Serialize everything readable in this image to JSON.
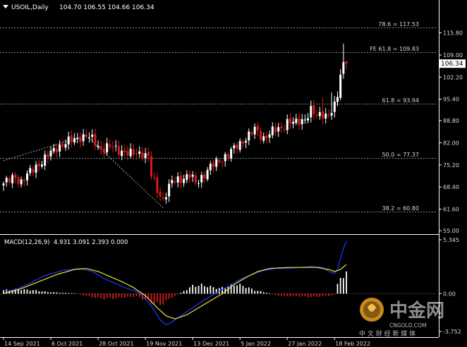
{
  "chart_data": [
    {
      "type": "candlestick",
      "title": "USOIL,Daily",
      "ohlc_readout": [
        "104.70",
        "106.55",
        "104.66",
        "106.34"
      ],
      "current_price": "106.34",
      "ylim": [
        55.0,
        122.0
      ],
      "y_ticks": [
        "115.80",
        "109.00",
        "102.20",
        "95.40",
        "88.80",
        "82.00",
        "75.20",
        "68.40",
        "61.60",
        "55.00"
      ],
      "x_labels": [
        {
          "t": 0,
          "label": "14 Sep 2021"
        },
        {
          "t": 16,
          "label": "6 Oct 2021"
        },
        {
          "t": 32,
          "label": "28 Oct 2021"
        },
        {
          "t": 48,
          "label": "19 Nov 2021"
        },
        {
          "t": 64,
          "label": "13 Dec 2021"
        },
        {
          "t": 80,
          "label": "5 Jan 2022"
        },
        {
          "t": 96,
          "label": "27 Jan 2022"
        },
        {
          "t": 112,
          "label": "18 Feb 2022"
        }
      ],
      "fib_levels": [
        {
          "label": "78.6 = 117.53",
          "value": 117.53
        },
        {
          "label": "FE 61.8 = 109.83",
          "value": 109.83
        },
        {
          "label": "61.8 = 93.94",
          "value": 93.94
        },
        {
          "label": "50.0 = 77.37",
          "value": 77.37
        },
        {
          "label": "38.2 = 60.80",
          "value": 60.8
        }
      ],
      "trendlines": [
        {
          "from": [
            0,
            76.5
          ],
          "to": [
            28,
            84.3
          ]
        },
        {
          "from": [
            28,
            84.3
          ],
          "to": [
            54,
            62.0
          ]
        }
      ],
      "anchors": [
        [
          0,
          69.5
        ],
        [
          4,
          71.5
        ],
        [
          6,
          70.0
        ],
        [
          9,
          73.0
        ],
        [
          12,
          75.5
        ],
        [
          15,
          78.0
        ],
        [
          18,
          80.5
        ],
        [
          21,
          82.0
        ],
        [
          24,
          83.0
        ],
        [
          26,
          83.8
        ],
        [
          28,
          84.0
        ],
        [
          30,
          83.0
        ],
        [
          33,
          80.0
        ],
        [
          36,
          80.8
        ],
        [
          40,
          79.5
        ],
        [
          43,
          78.5
        ],
        [
          47,
          79.0
        ],
        [
          49,
          77.5
        ],
        [
          50,
          72.0
        ],
        [
          52,
          67.5
        ],
        [
          54,
          64.5
        ],
        [
          55,
          66.5
        ],
        [
          57,
          70.0
        ],
        [
          60,
          71.0
        ],
        [
          63,
          72.0
        ],
        [
          65,
          69.5
        ],
        [
          67,
          71.5
        ],
        [
          70,
          74.5
        ],
        [
          73,
          76.5
        ],
        [
          76,
          78.5
        ],
        [
          79,
          81.0
        ],
        [
          82,
          83.5
        ],
        [
          85,
          86.0
        ],
        [
          88,
          83.5
        ],
        [
          91,
          85.5
        ],
        [
          94,
          86.5
        ],
        [
          96,
          88.5
        ],
        [
          99,
          88.0
        ],
        [
          102,
          89.5
        ],
        [
          104,
          92.0
        ],
        [
          106,
          90.0
        ],
        [
          108,
          91.0
        ],
        [
          110,
          90.5
        ],
        [
          112,
          93.0
        ],
        [
          113,
          96.5
        ],
        [
          114,
          103.0
        ],
        [
          115,
          106.5
        ],
        [
          116,
          106.34
        ]
      ],
      "spikes": [
        {
          "t": 108,
          "high": 96.0
        },
        {
          "t": 111,
          "high": 97.5
        },
        {
          "t": 115,
          "high": 112.5
        }
      ]
    },
    {
      "type": "macd",
      "title": "MACD(12,26,9)",
      "readout": [
        "4.931",
        "3.091",
        "2.393",
        "0.000"
      ],
      "y_ticks": [
        "5.345",
        "0.00",
        "-3.752"
      ],
      "ylim": [
        -3.752,
        5.345
      ],
      "macd_anchors": [
        [
          0,
          0.2
        ],
        [
          4,
          0.4
        ],
        [
          8,
          0.9
        ],
        [
          14,
          1.8
        ],
        [
          20,
          2.3
        ],
        [
          26,
          2.5
        ],
        [
          30,
          2.2
        ],
        [
          34,
          1.5
        ],
        [
          38,
          1.0
        ],
        [
          42,
          0.5
        ],
        [
          46,
          0.1
        ],
        [
          50,
          -1.2
        ],
        [
          53,
          -2.6
        ],
        [
          55,
          -3.1
        ],
        [
          57,
          -2.8
        ],
        [
          60,
          -2.2
        ],
        [
          64,
          -1.4
        ],
        [
          68,
          -0.6
        ],
        [
          72,
          0.1
        ],
        [
          76,
          0.7
        ],
        [
          80,
          1.4
        ],
        [
          84,
          1.9
        ],
        [
          88,
          2.3
        ],
        [
          92,
          2.5
        ],
        [
          96,
          2.5
        ],
        [
          100,
          2.6
        ],
        [
          104,
          2.7
        ],
        [
          108,
          2.6
        ],
        [
          110,
          2.2
        ],
        [
          112,
          2.0
        ],
        [
          113,
          2.4
        ],
        [
          114,
          3.5
        ],
        [
          115,
          4.5
        ],
        [
          116,
          5.2
        ]
      ],
      "signal_anchors": [
        [
          0,
          0.0
        ],
        [
          6,
          0.5
        ],
        [
          12,
          1.2
        ],
        [
          18,
          1.9
        ],
        [
          24,
          2.4
        ],
        [
          28,
          2.5
        ],
        [
          32,
          2.2
        ],
        [
          36,
          1.7
        ],
        [
          40,
          1.2
        ],
        [
          44,
          0.6
        ],
        [
          48,
          -0.2
        ],
        [
          52,
          -1.4
        ],
        [
          55,
          -2.2
        ],
        [
          58,
          -2.5
        ],
        [
          62,
          -2.1
        ],
        [
          66,
          -1.4
        ],
        [
          70,
          -0.7
        ],
        [
          74,
          0.0
        ],
        [
          78,
          0.9
        ],
        [
          82,
          1.6
        ],
        [
          86,
          2.2
        ],
        [
          90,
          2.5
        ],
        [
          96,
          2.6
        ],
        [
          102,
          2.6
        ],
        [
          106,
          2.6
        ],
        [
          110,
          2.4
        ],
        [
          112,
          2.2
        ],
        [
          114,
          2.4
        ],
        [
          116,
          2.9
        ]
      ],
      "histogram_anchors": [
        [
          0,
          0.4
        ],
        [
          5,
          0.5
        ],
        [
          10,
          0.4
        ],
        [
          15,
          0.2
        ],
        [
          20,
          0.1
        ],
        [
          24,
          0.05
        ],
        [
          26,
          -0.1
        ],
        [
          30,
          -0.4
        ],
        [
          34,
          -0.6
        ],
        [
          38,
          -0.5
        ],
        [
          42,
          -0.4
        ],
        [
          45,
          -0.3
        ],
        [
          47,
          -0.6
        ],
        [
          50,
          -1.0
        ],
        [
          53,
          -1.3
        ],
        [
          55,
          -0.9
        ],
        [
          57,
          -0.4
        ],
        [
          59,
          -0.1
        ],
        [
          61,
          0.3
        ],
        [
          64,
          0.9
        ],
        [
          67,
          1.0
        ],
        [
          70,
          0.8
        ],
        [
          73,
          0.6
        ],
        [
          76,
          0.9
        ],
        [
          79,
          1.1
        ],
        [
          82,
          0.8
        ],
        [
          85,
          0.4
        ],
        [
          88,
          0.2
        ],
        [
          90,
          0.05
        ],
        [
          92,
          -0.2
        ],
        [
          96,
          -0.3
        ],
        [
          100,
          -0.3
        ],
        [
          104,
          -0.4
        ],
        [
          108,
          -0.3
        ],
        [
          111,
          -0.2
        ],
        [
          112,
          -0.1
        ],
        [
          113,
          1.0
        ],
        [
          114,
          1.8
        ],
        [
          115,
          2.2
        ],
        [
          116,
          2.4
        ]
      ]
    }
  ],
  "logo": {
    "name": "中金网",
    "domain": "CNGOLD.COM",
    "tagline": "中 文 财 经 新 媒 体"
  },
  "colors": {
    "background": "#000000",
    "up_candle": "#ffffff",
    "down_candle": "#d9191b",
    "grid_dash": "#b8b8b8",
    "macd_line": "#1e3cff",
    "signal_line": "#e8e834",
    "histogram": "#ffffff",
    "axis_text": "#d8d8d8"
  }
}
